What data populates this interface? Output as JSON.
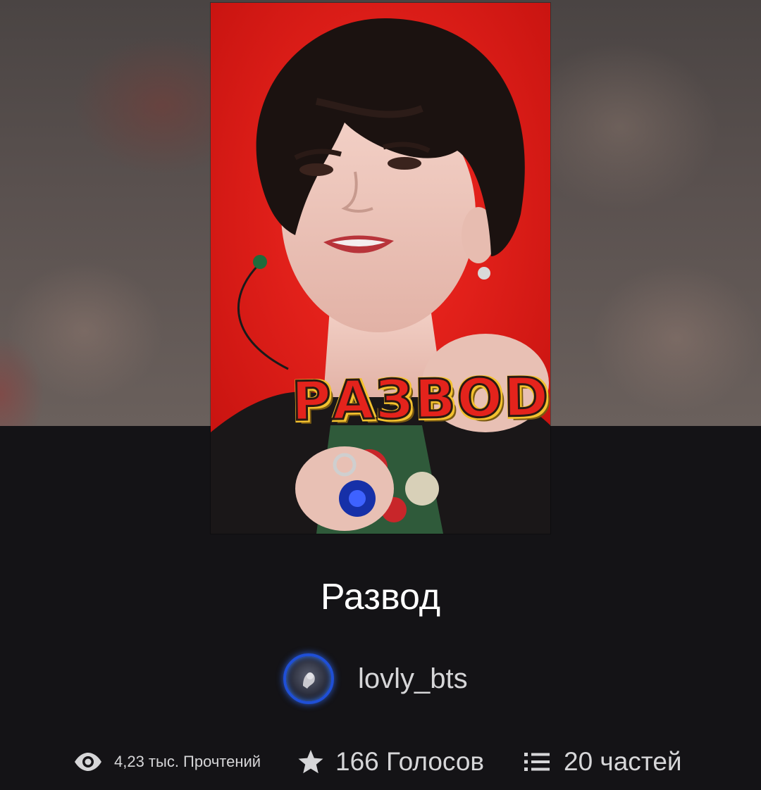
{
  "story": {
    "title": "Развод",
    "cover": {
      "title_text": "РАЗВОD",
      "background_color": "#e81b1b",
      "title_color": "#e4231c",
      "title_outline_color": "#f3c12e"
    },
    "author": {
      "username": "lovly_bts",
      "avatar_ring_color": "#1f4fd6"
    }
  },
  "stats": {
    "reads": {
      "icon": "eye-icon",
      "label": "4,23 тыс. Прочтений"
    },
    "votes": {
      "icon": "star-icon",
      "label": "166 Голосов"
    },
    "parts": {
      "icon": "list-icon",
      "label": "20 частей"
    }
  },
  "colors": {
    "page_background": "#141316",
    "title_text": "#ffffff",
    "secondary_text": "#d6d6d8"
  }
}
